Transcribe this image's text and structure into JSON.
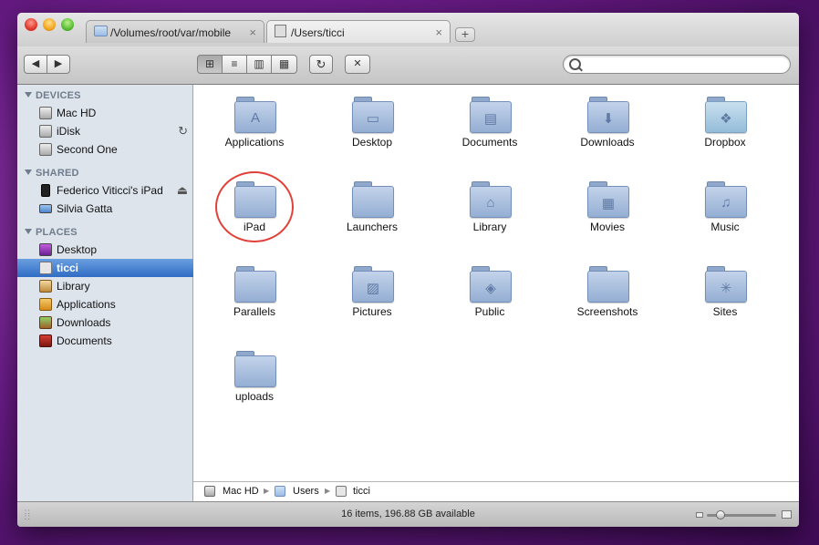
{
  "tabs": [
    {
      "label": "/Volumes/root/var/mobile",
      "close": "×",
      "state": "inactive"
    },
    {
      "label": "/Users/ticci",
      "close": "×",
      "state": "active"
    }
  ],
  "new_tab_label": "+",
  "toolbar": {
    "back_label": "◀",
    "forward_label": "▶",
    "view_icons": "⊞",
    "view_list": "≡",
    "view_columns": "▥",
    "view_coverflow": "▦",
    "refresh_label": "↻",
    "action_label": "✕",
    "search_placeholder": "",
    "search_value": ""
  },
  "sidebar": {
    "sections": [
      {
        "title": "DEVICES",
        "items": [
          {
            "label": "Mac HD",
            "accessory": ""
          },
          {
            "label": "iDisk",
            "accessory": "↻"
          },
          {
            "label": "Second One",
            "accessory": ""
          }
        ]
      },
      {
        "title": "SHARED",
        "items": [
          {
            "label": "Federico Viticci's iPad",
            "accessory": "⏏"
          },
          {
            "label": "Silvia Gatta",
            "accessory": ""
          }
        ]
      },
      {
        "title": "PLACES",
        "items": [
          {
            "label": "Desktop",
            "accessory": ""
          },
          {
            "label": "ticci",
            "accessory": "",
            "selected": true
          },
          {
            "label": "Library",
            "accessory": ""
          },
          {
            "label": "Applications",
            "accessory": ""
          },
          {
            "label": "Downloads",
            "accessory": ""
          },
          {
            "label": "Documents",
            "accessory": ""
          }
        ]
      }
    ]
  },
  "items": [
    {
      "label": "Applications",
      "icon": "applications-folder-icon",
      "emblem": "A"
    },
    {
      "label": "Desktop",
      "icon": "desktop-folder-icon",
      "emblem": "▭"
    },
    {
      "label": "Documents",
      "icon": "documents-folder-icon",
      "emblem": "▤"
    },
    {
      "label": "Downloads",
      "icon": "downloads-folder-icon",
      "emblem": "⬇"
    },
    {
      "label": "Dropbox",
      "icon": "dropbox-folder-icon",
      "emblem": "❖"
    },
    {
      "label": "iPad",
      "icon": "folder-icon",
      "emblem": ""
    },
    {
      "label": "Launchers",
      "icon": "folder-icon",
      "emblem": ""
    },
    {
      "label": "Library",
      "icon": "library-folder-icon",
      "emblem": "⌂"
    },
    {
      "label": "Movies",
      "icon": "movies-folder-icon",
      "emblem": "▦"
    },
    {
      "label": "Music",
      "icon": "music-folder-icon",
      "emblem": "♫"
    },
    {
      "label": "Parallels",
      "icon": "folder-icon",
      "emblem": ""
    },
    {
      "label": "Pictures",
      "icon": "pictures-folder-icon",
      "emblem": "▨"
    },
    {
      "label": "Public",
      "icon": "public-folder-icon",
      "emblem": "◈"
    },
    {
      "label": "Screenshots",
      "icon": "folder-icon",
      "emblem": ""
    },
    {
      "label": "Sites",
      "icon": "sites-folder-icon",
      "emblem": "✳"
    },
    {
      "label": "uploads",
      "icon": "folder-icon",
      "emblem": ""
    }
  ],
  "highlighted_item": "iPad",
  "pathbar": [
    "Mac HD",
    "Users",
    "ticci"
  ],
  "status": "16 items, 196.88 GB available",
  "icon_size_slider_fraction": 0.2,
  "colors": {
    "selection": "#3b78cf",
    "highlight_circle": "#e2413a",
    "sidebar_bg": "#dde4ec"
  }
}
